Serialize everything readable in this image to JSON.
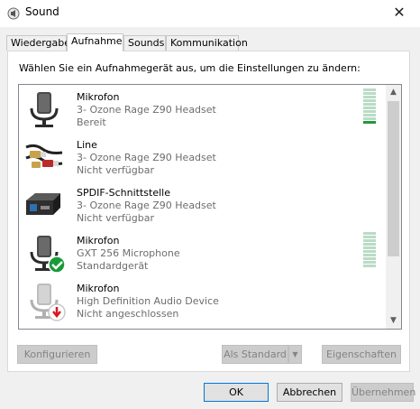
{
  "window": {
    "title": "Sound",
    "icon": "speaker-icon",
    "close": "✕"
  },
  "tabs": [
    {
      "label": "Wiedergabe",
      "active": false
    },
    {
      "label": "Aufnahme",
      "active": true
    },
    {
      "label": "Sounds",
      "active": false
    },
    {
      "label": "Kommunikation",
      "active": false
    }
  ],
  "instruction": "Wählen Sie ein Aufnahmegerät aus, um die Einstellungen zu ändern:",
  "devices": [
    {
      "name": "Mikrofon",
      "line1": "3- Ozone Rage Z90 Headset",
      "line2": "Bereit",
      "icon": "microphone-icon",
      "meter": true,
      "level": 1
    },
    {
      "name": "Line",
      "line1": "3- Ozone Rage Z90 Headset",
      "line2": "Nicht verfügbar",
      "icon": "rca-cable-icon",
      "meter": false
    },
    {
      "name": "SPDIF-Schnittstelle",
      "line1": "3- Ozone Rage Z90 Headset",
      "line2": "Nicht verfügbar",
      "icon": "spdif-device-icon",
      "meter": false
    },
    {
      "name": "Mikrofon",
      "line1": "GXT 256 Microphone",
      "line2": "Standardgerät",
      "icon": "microphone-default-icon",
      "meter": true,
      "level": 0
    },
    {
      "name": "Mikrofon",
      "line1": "High Definition Audio Device",
      "line2": "Nicht angeschlossen",
      "icon": "microphone-unplugged-icon",
      "meter": false
    }
  ],
  "buttons": {
    "configure": "Konfigurieren",
    "set_default": "Als Standard",
    "properties": "Eigenschaften",
    "ok": "OK",
    "cancel": "Abbrechen",
    "apply": "Übernehmen"
  },
  "colors": {
    "meter_idle": "#b9dcc6",
    "meter_active": "#1f9a3a",
    "accent": "#0078d7"
  }
}
